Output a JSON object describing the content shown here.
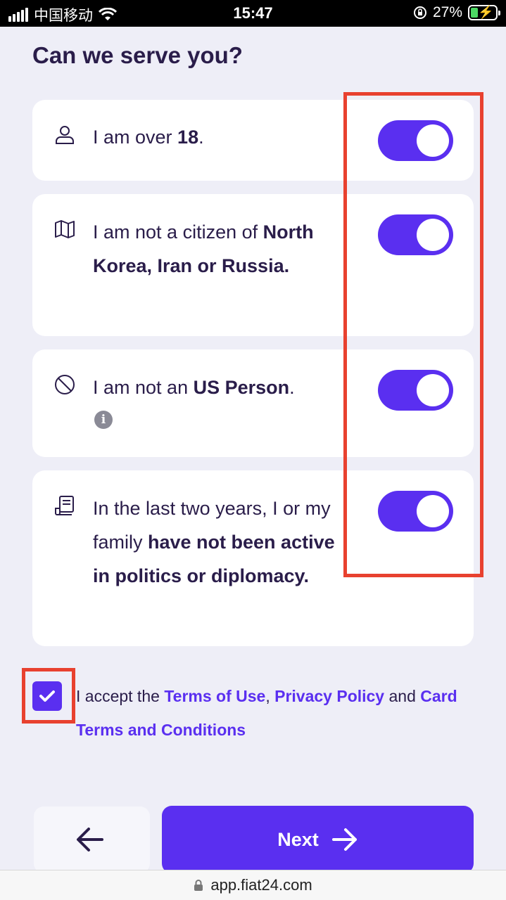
{
  "status_bar": {
    "carrier": "中国移动",
    "time": "15:47",
    "battery": "27%",
    "battery_level": 0.27
  },
  "page": {
    "title": "Can we serve you?"
  },
  "cards": [
    {
      "icon": "user-icon",
      "text_plain": "I am over ",
      "text_bold": "18",
      "text_end": ".",
      "toggle_on": true
    },
    {
      "icon": "map-icon",
      "text_plain": "I am not a citizen of ",
      "text_bold": "North Korea, Iran or Russia.",
      "text_end": "",
      "toggle_on": true
    },
    {
      "icon": "ban-icon",
      "text_plain": "I am not an ",
      "text_bold": "US Person",
      "text_end": ".",
      "toggle_on": true,
      "info_icon": "info-icon"
    },
    {
      "icon": "document-icon",
      "text_plain": "In the last two years, I or my family ",
      "text_bold": "have not been active in politics or diplomacy.",
      "text_end": "",
      "toggle_on": true
    }
  ],
  "terms": {
    "checked": true,
    "prefix": "I accept the ",
    "link1": "Terms of Use",
    "sep": ", ",
    "link2": "Privacy Policy",
    "and": " and ",
    "link3": "Card Terms and Conditions"
  },
  "nav": {
    "next_label": "Next"
  },
  "browser": {
    "url": "app.fiat24.com"
  },
  "colors": {
    "accent": "#5a2ff0",
    "text": "#2a1d4a",
    "background": "#eeeef7",
    "highlight": "#e8412f"
  }
}
